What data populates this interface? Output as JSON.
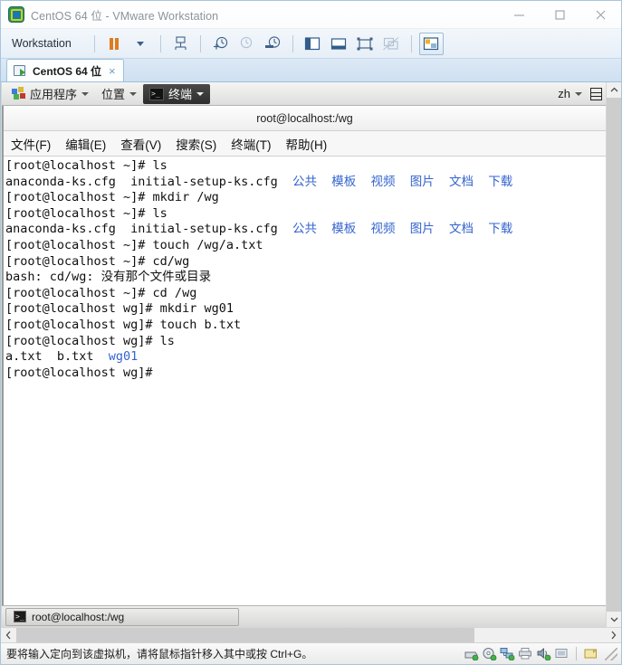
{
  "window": {
    "title": "CentOS 64 位 - VMware Workstation",
    "app_icon": "vmware-vm-icon",
    "minimize_label": "—",
    "maximize_label": "□",
    "close_label": "✕"
  },
  "toolbar": {
    "workstation_menu": "Workstation",
    "buttons": [
      {
        "name": "suspend-button",
        "icon": "pause-icon"
      },
      {
        "name": "power-dropdown-button",
        "icon": "chevron-down-icon"
      },
      {
        "name": "manage-snapshot-button",
        "icon": "snapshot-manager-icon"
      },
      {
        "name": "take-snapshot-button",
        "icon": "snapshot-add-icon"
      },
      {
        "name": "revert-snapshot-button",
        "icon": "snapshot-revert-icon"
      },
      {
        "name": "snapshot-manager-button",
        "icon": "snapshot-clock-icon"
      },
      {
        "name": "show-library-button",
        "icon": "library-panel-icon"
      },
      {
        "name": "show-thumbnail-bar-button",
        "icon": "thumbnail-bar-icon"
      },
      {
        "name": "full-screen-button",
        "icon": "fullscreen-icon"
      },
      {
        "name": "unity-mode-button",
        "icon": "unity-mode-icon"
      },
      {
        "name": "console-view-button",
        "icon": "console-view-icon"
      }
    ]
  },
  "tab": {
    "label": "CentOS 64 位",
    "close": "×",
    "icon": "vm-tab-icon"
  },
  "guest": {
    "top_panel": {
      "applications": "应用程序",
      "places": "位置",
      "terminal": "终端",
      "input_method": "zh",
      "calendar_icon": "calendar-icon"
    },
    "terminal": {
      "title": "root@localhost:/wg",
      "menus": [
        "文件(F)",
        "编辑(E)",
        "查看(V)",
        "搜索(S)",
        "终端(T)",
        "帮助(H)"
      ],
      "lines": [
        {
          "segments": [
            {
              "text": "[root@localhost ~]# ls",
              "color": "normal"
            }
          ]
        },
        {
          "segments": [
            {
              "text": "anaconda-ks.cfg  initial-setup-ks.cfg  ",
              "color": "normal"
            },
            {
              "text": "公共  模板  视频  图片  文档  下载",
              "color": "dir"
            }
          ]
        },
        {
          "segments": [
            {
              "text": "[root@localhost ~]# mkdir /wg",
              "color": "normal"
            }
          ]
        },
        {
          "segments": [
            {
              "text": "[root@localhost ~]# ls",
              "color": "normal"
            }
          ]
        },
        {
          "segments": [
            {
              "text": "anaconda-ks.cfg  initial-setup-ks.cfg  ",
              "color": "normal"
            },
            {
              "text": "公共  模板  视频  图片  文档  下载",
              "color": "dir"
            }
          ]
        },
        {
          "segments": [
            {
              "text": "[root@localhost ~]# touch /wg/a.txt",
              "color": "normal"
            }
          ]
        },
        {
          "segments": [
            {
              "text": "[root@localhost ~]# cd/wg",
              "color": "normal"
            }
          ]
        },
        {
          "segments": [
            {
              "text": "bash: cd/wg: 没有那个文件或目录",
              "color": "normal"
            }
          ]
        },
        {
          "segments": [
            {
              "text": "[root@localhost ~]# cd /wg",
              "color": "normal"
            }
          ]
        },
        {
          "segments": [
            {
              "text": "[root@localhost wg]# mkdir wg01",
              "color": "normal"
            }
          ]
        },
        {
          "segments": [
            {
              "text": "[root@localhost wg]# touch b.txt",
              "color": "normal"
            }
          ]
        },
        {
          "segments": [
            {
              "text": "[root@localhost wg]# ls",
              "color": "normal"
            }
          ]
        },
        {
          "segments": [
            {
              "text": "a.txt  b.txt  ",
              "color": "normal"
            },
            {
              "text": "wg01",
              "color": "dir"
            }
          ]
        },
        {
          "segments": [
            {
              "text": "[root@localhost wg]# ",
              "color": "normal"
            }
          ]
        }
      ]
    },
    "taskbar": {
      "window_button": "root@localhost:/wg",
      "window_icon": "terminal-icon"
    }
  },
  "scrollbars": {
    "up_arrow": "⌃",
    "down_arrow": "⌄",
    "left_arrow": "‹",
    "right_arrow": "›"
  },
  "statusbar": {
    "message": "要将输入定向到该虚拟机，请将鼠标指针移入其中或按 Ctrl+G。",
    "devices": [
      {
        "name": "hard-disk-icon"
      },
      {
        "name": "cd-dvd-icon"
      },
      {
        "name": "network-adapter-icon"
      },
      {
        "name": "printer-icon"
      },
      {
        "name": "sound-card-icon"
      },
      {
        "name": "usb-device-icon"
      },
      {
        "name": "shared-folder-icon"
      }
    ]
  },
  "colors": {
    "accent": "#3464cf",
    "vm_chrome": "#a8c4dc",
    "toolbar_orange": "#e07b1e"
  }
}
